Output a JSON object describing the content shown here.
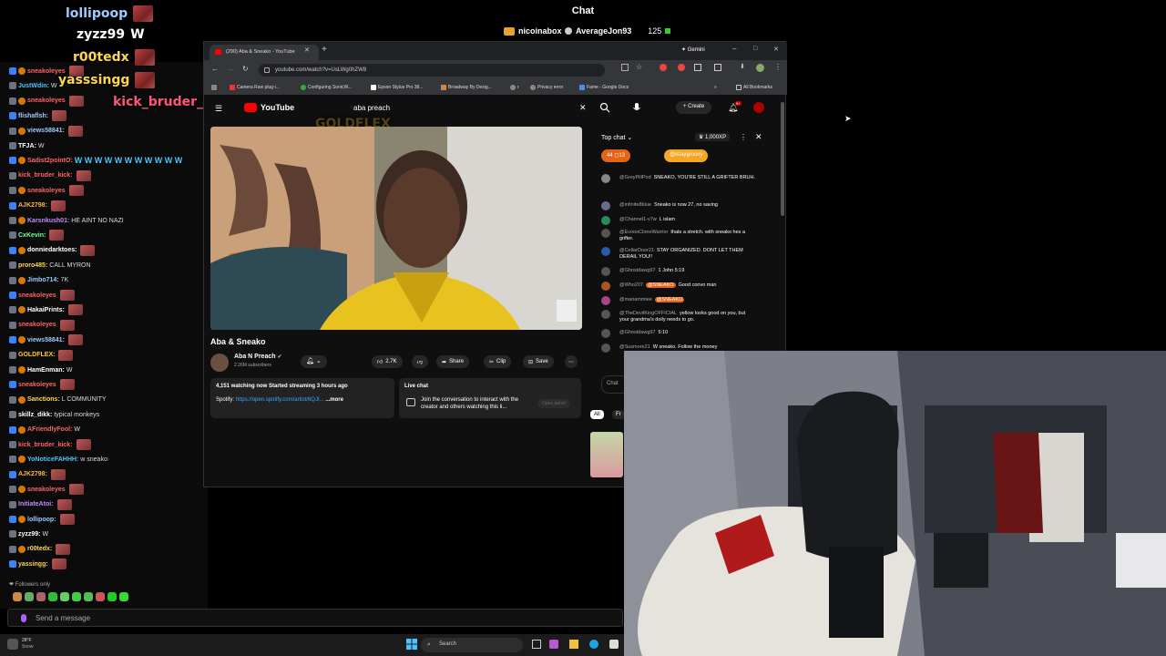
{
  "stream_overlay": {
    "title": "Chat",
    "recent_subs": [
      {
        "name": "nicoinabox"
      },
      {
        "name": "AverageJon93",
        "count": "125"
      }
    ],
    "alerts": [
      {
        "text": "lollipoop",
        "color": "#9ecbff"
      },
      {
        "text": "zyzz99",
        "extra": "W",
        "color": "#ffffff"
      },
      {
        "text": "r00tedx",
        "color": "#ffd84a"
      },
      {
        "text": "yasssingg",
        "color": "#ffd84a"
      },
      {
        "text": "kick_bruder_kick",
        "color": "#ff5577"
      },
      {
        "text": "GOLDFLEX",
        "color": "#ffcc33"
      }
    ]
  },
  "left_chat": {
    "messages": [
      {
        "user": "sneakoleyes",
        "text": "",
        "color": "#ff6464"
      },
      {
        "user": "JustWdin:",
        "text": "W",
        "color": "#4fc3f7"
      },
      {
        "user": "sneakoleyes",
        "text": "",
        "color": "#ff6464"
      },
      {
        "user": "flishaflsh:",
        "text": "",
        "color": "#9ecbff"
      },
      {
        "user": "views58841:",
        "text": "",
        "color": "#9ecbff"
      },
      {
        "user": "TFJA:",
        "text": "W",
        "color": "#ffffff"
      },
      {
        "user": "Sadist2pointO:",
        "text": "W W W W W W W W W W W",
        "color": "#ff6464"
      },
      {
        "user": "kick_bruder_kick:",
        "text": "",
        "color": "#ff6464"
      },
      {
        "user": "sneakoleyes",
        "text": "",
        "color": "#ff6464"
      },
      {
        "user": "AJK2798:",
        "text": "",
        "color": "#ffb347"
      },
      {
        "user": "Karsnkush01:",
        "text": "HE AINT NO NAZI",
        "color": "#c08cff"
      },
      {
        "user": "CxKevin:",
        "text": "",
        "color": "#7cfc9b"
      },
      {
        "user": "donniedarktoes:",
        "text": "",
        "color": "#ffffff"
      },
      {
        "user": "proro485:",
        "text": "CALL MYRON",
        "color": "#ffd84a"
      },
      {
        "user": "Jimbo714:",
        "text": "7K",
        "color": "#9ecbff"
      },
      {
        "user": "sneakoleyes",
        "text": "",
        "color": "#ff6464"
      },
      {
        "user": "HakaiPrints:",
        "text": "",
        "color": "#ffffff"
      },
      {
        "user": "sneakoleyes",
        "text": "",
        "color": "#ff6464"
      },
      {
        "user": "views58841:",
        "text": "",
        "color": "#9ecbff"
      },
      {
        "user": "GOLDFLEX:",
        "text": "",
        "color": "#ffcc33"
      },
      {
        "user": "HamEnman:",
        "text": "W",
        "color": "#ffffff"
      },
      {
        "user": "sneakoleyes",
        "text": "",
        "color": "#ff6464"
      },
      {
        "user": "Sanctions:",
        "text": "L COMMUNITY",
        "color": "#ffd84a"
      },
      {
        "user": "skillz_dikk:",
        "text": "typical monkeys",
        "color": "#ffffff"
      },
      {
        "user": "AFriendlyFool:",
        "text": "W",
        "color": "#ff6464"
      },
      {
        "user": "kick_bruder_kick:",
        "text": "",
        "color": "#ff6464"
      },
      {
        "user": "YoNoticeFAHHH:",
        "text": "w sneako",
        "color": "#4fc3f7"
      },
      {
        "user": "AJK2798:",
        "text": "",
        "color": "#ffb347"
      },
      {
        "user": "sneakoleyes",
        "text": "",
        "color": "#ff6464"
      },
      {
        "user": "InitiateAtoi:",
        "text": "",
        "color": "#c08cff"
      },
      {
        "user": "lollipoop:",
        "text": "",
        "color": "#9ecbff"
      },
      {
        "user": "zyzz99:",
        "text": "W",
        "color": "#ffffff"
      },
      {
        "user": "r00tedx:",
        "text": "",
        "color": "#ffd84a"
      },
      {
        "user": "yassingg:",
        "text": "",
        "color": "#ffd84a"
      }
    ],
    "followers_only": "Followers only",
    "send_placeholder": "Send a message"
  },
  "browser": {
    "tab_title": "(290) Aba & Sneako - YouTube",
    "gemini_label": "Gemini",
    "url": "youtube.com/watch?v=UsLWg0hZW8",
    "bookmarks": [
      "Camera Raw plug-i...",
      "Configuring SonicW...",
      "Epson Stylus Pro 38...",
      "Broadway By Desig...",
      "r",
      "Privacy error",
      "Fame - Google Docs"
    ],
    "all_bookmarks": "All Bookmarks"
  },
  "youtube": {
    "logo_text": "YouTube",
    "search_value": "aba preach",
    "create_label": "Create",
    "notif_count": "9+",
    "video_title": "Aba & Sneako",
    "channel_name": "Aba N Preach",
    "subscribers": "2.26M subscribers",
    "likes": "2.7K",
    "share_label": "Share",
    "clip_label": "Clip",
    "save_label": "Save",
    "watching": "4,151 watching now  Started streaming 3 hours ago",
    "desc_line": "Spotify:",
    "desc_link": "https://open.spotify.com/artist/6QJI...",
    "more_label": "...more",
    "livechat_title": "Live chat",
    "livechat_text": "Join the conversation to interact with the creator and others watching this li...",
    "open_panel": "Open panel",
    "filter_all": "All",
    "filter_fr": "Fr"
  },
  "live_chat": {
    "header": "Top chat",
    "xp": "1,000XP",
    "pill1": "44",
    "pill1b": "13",
    "pill2": "@istaygroovy",
    "chat_placeholder": "Chat",
    "messages": [
      {
        "user": "@GreyPillPod",
        "text": "SNEAKO, YOU'RE STILL A GRIFTER BRUH.",
        "color": "#888"
      },
      {
        "user": "@infinite8blue",
        "text": "Sneako is now 27, no saving",
        "color": "#6a6a8a"
      },
      {
        "user": "@Channel1-v7w",
        "text": "L islam",
        "color": "#2a8a5a"
      },
      {
        "user": "@EvoooCloneWarrior",
        "text": "thats a stretch. with sneako hes a grifter.",
        "color": "#555"
      },
      {
        "user": "@CellarDoor21",
        "text": "STAY ORGANIZED. DONT LET THEM DERAIL YOU!!",
        "color": "#2a5aa8"
      },
      {
        "user": "@Ghostdawg97",
        "text": "1 John 5:19",
        "color": "#555"
      },
      {
        "user": "@Who207",
        "text": "Good convo man",
        "color": "#aa5522"
      },
      {
        "user": "@mariammiee",
        "text": "",
        "color": "#aa4488"
      },
      {
        "user": "@TheDevilKingOFFICIAL",
        "text": "yellow looks good on you, but your grandma's doily needs to go.",
        "color": "#555"
      },
      {
        "user": "@Ghostdawg97",
        "text": "5:10",
        "color": "#555"
      },
      {
        "user": "@Susmore21",
        "text": "W sneako. Follow the money",
        "color": "#555"
      }
    ],
    "highlight_tag": "@SNEAKO"
  },
  "taskbar": {
    "weather_temp": "28°F",
    "weather_text": "Snow",
    "search_label": "Search"
  }
}
